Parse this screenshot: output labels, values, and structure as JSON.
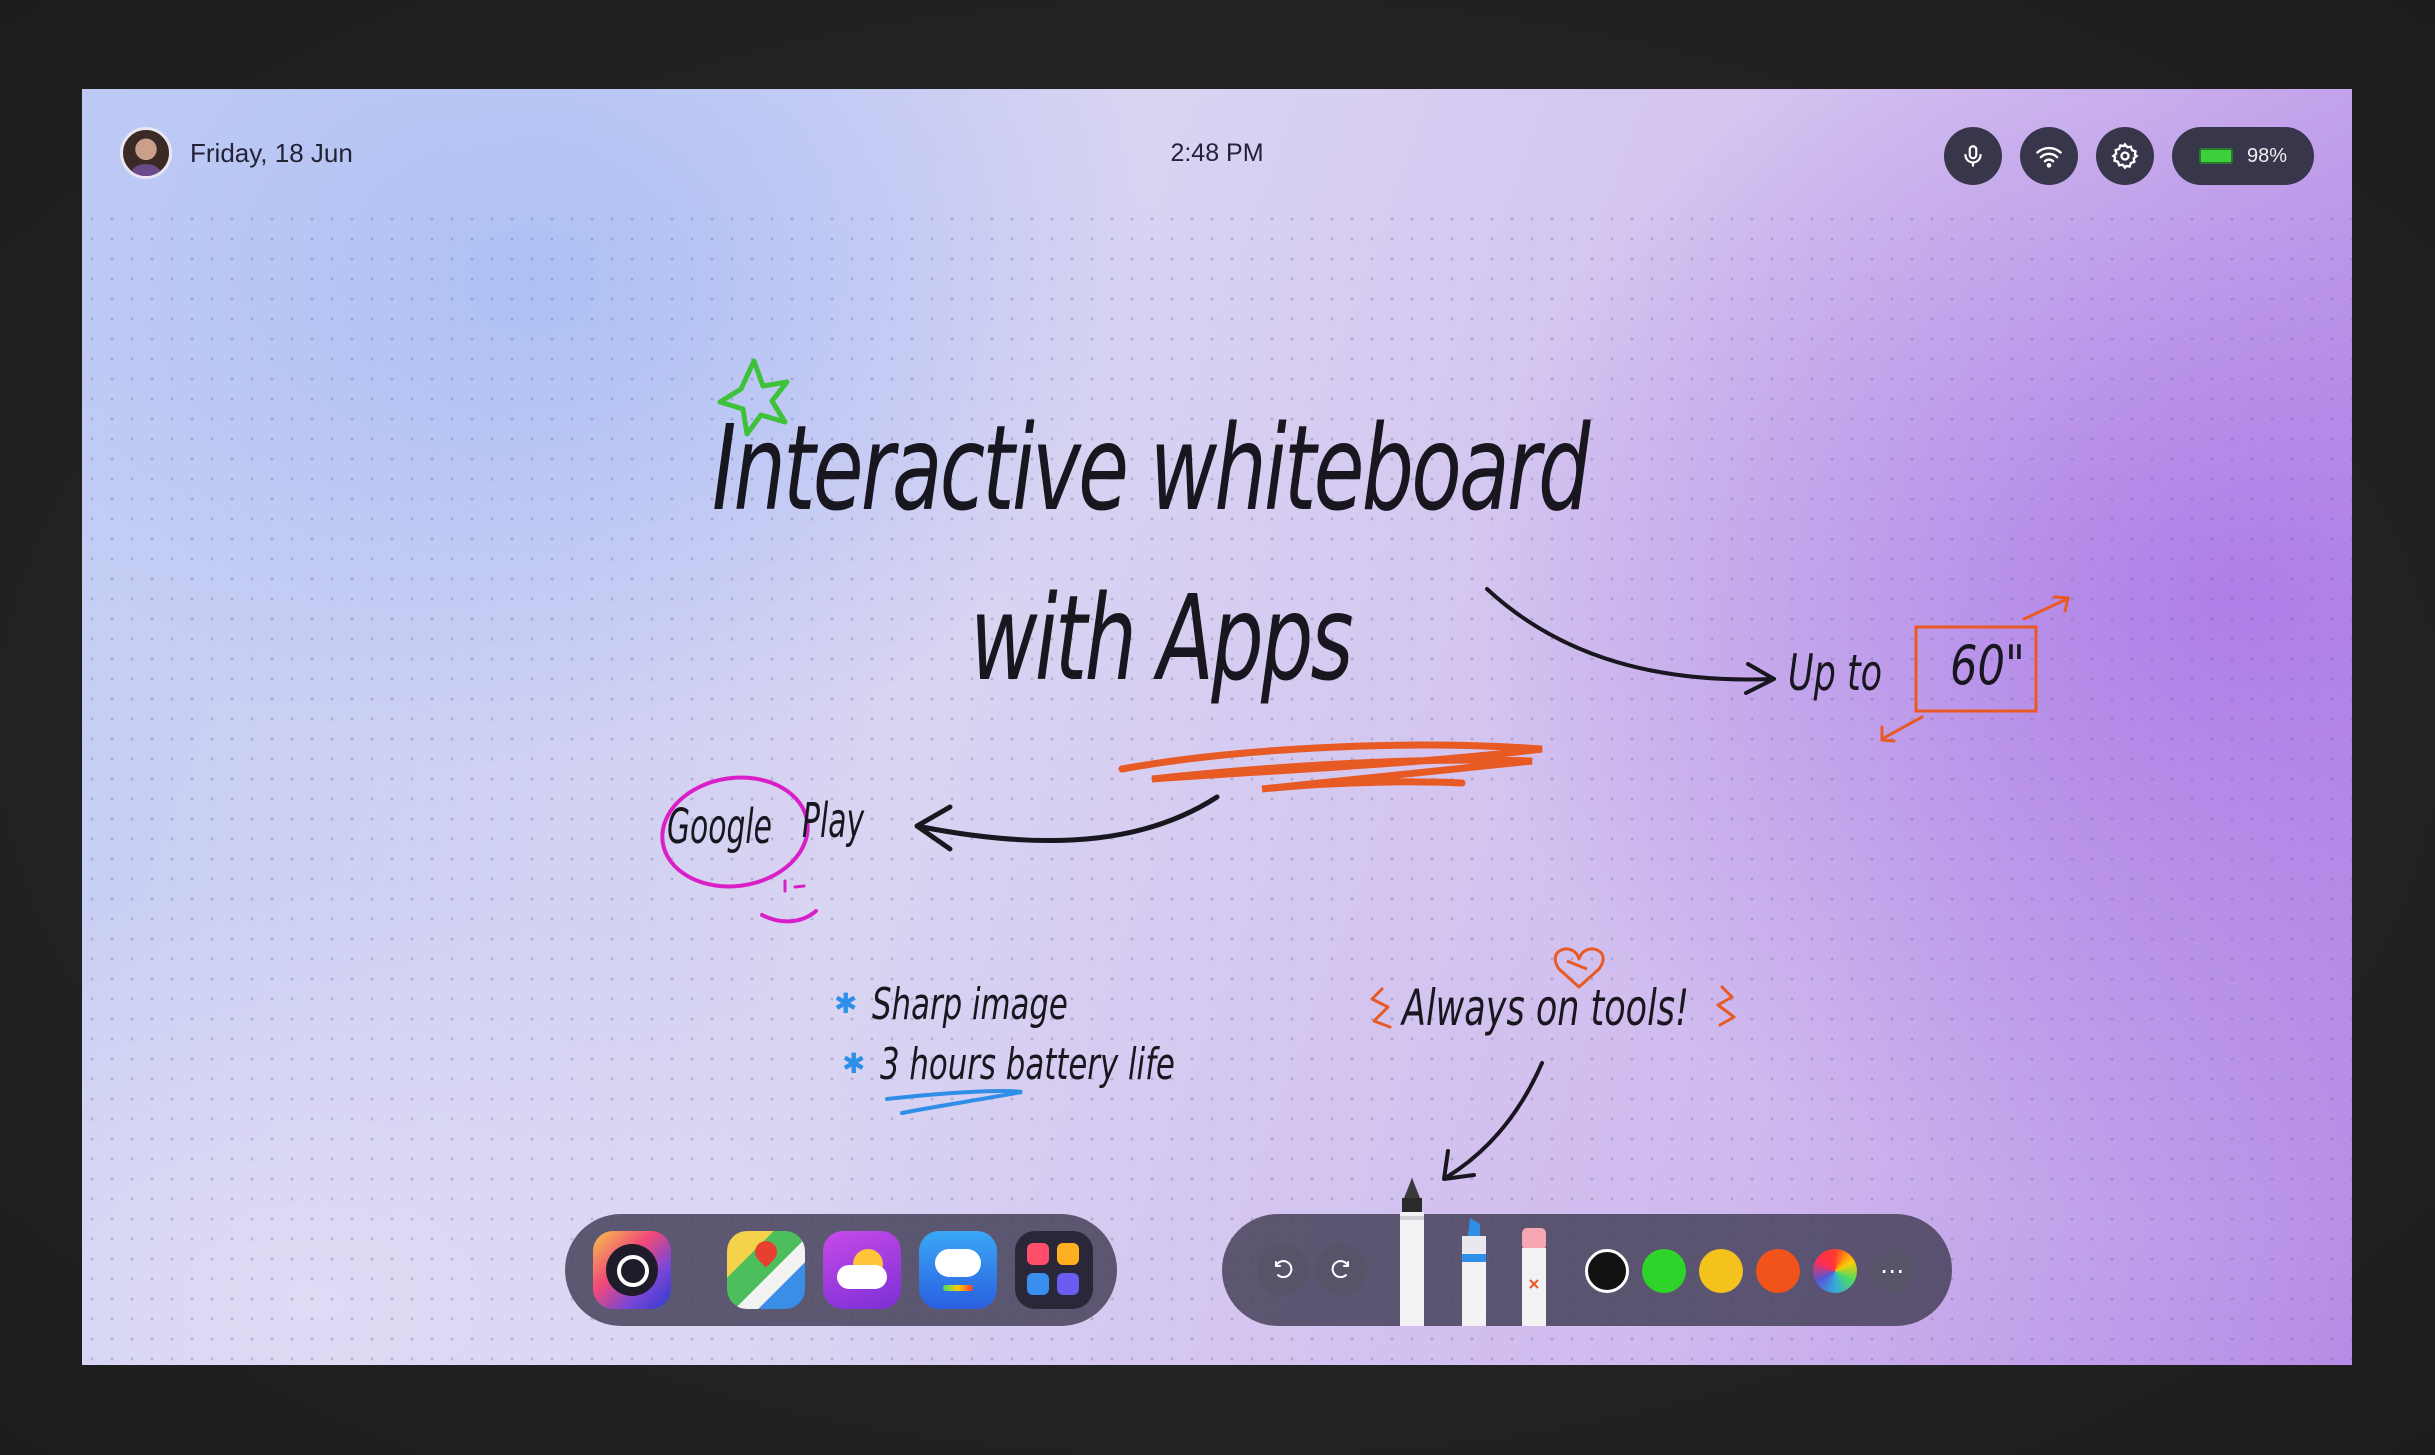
{
  "status_bar": {
    "date": "Friday, 18 Jun",
    "time": "2:48 PM",
    "battery": "98%",
    "icons": [
      "microphone-icon",
      "wifi-icon",
      "settings-icon",
      "battery-icon"
    ]
  },
  "board": {
    "title_line1": "Interactive whiteboard",
    "title_line2": "with Apps",
    "size_note_prefix": "Up to",
    "size_note_value": "60\"",
    "store_note_google": "Google",
    "store_note_play": "Play",
    "feature_1": "Sharp image",
    "feature_2": "3 hours battery life",
    "tools_note": "Always on tools!",
    "colors": {
      "ink": "#18161f",
      "accent_orange": "#e85a24",
      "accent_magenta": "#d81fc8",
      "accent_green": "#3ec23a",
      "accent_blue": "#2f8fe8"
    }
  },
  "app_dock": {
    "apps": [
      "camera-app",
      "maps-app",
      "weather-app",
      "cloud-app",
      "utilities-folder-app"
    ]
  },
  "tool_dock": {
    "actions": [
      "undo",
      "redo"
    ],
    "pens": [
      "marker",
      "highlighter",
      "eraser"
    ],
    "swatches": [
      "#111111",
      "#2fd42a",
      "#f4c21c",
      "#f2531b",
      "rainbow"
    ],
    "more": "more"
  }
}
